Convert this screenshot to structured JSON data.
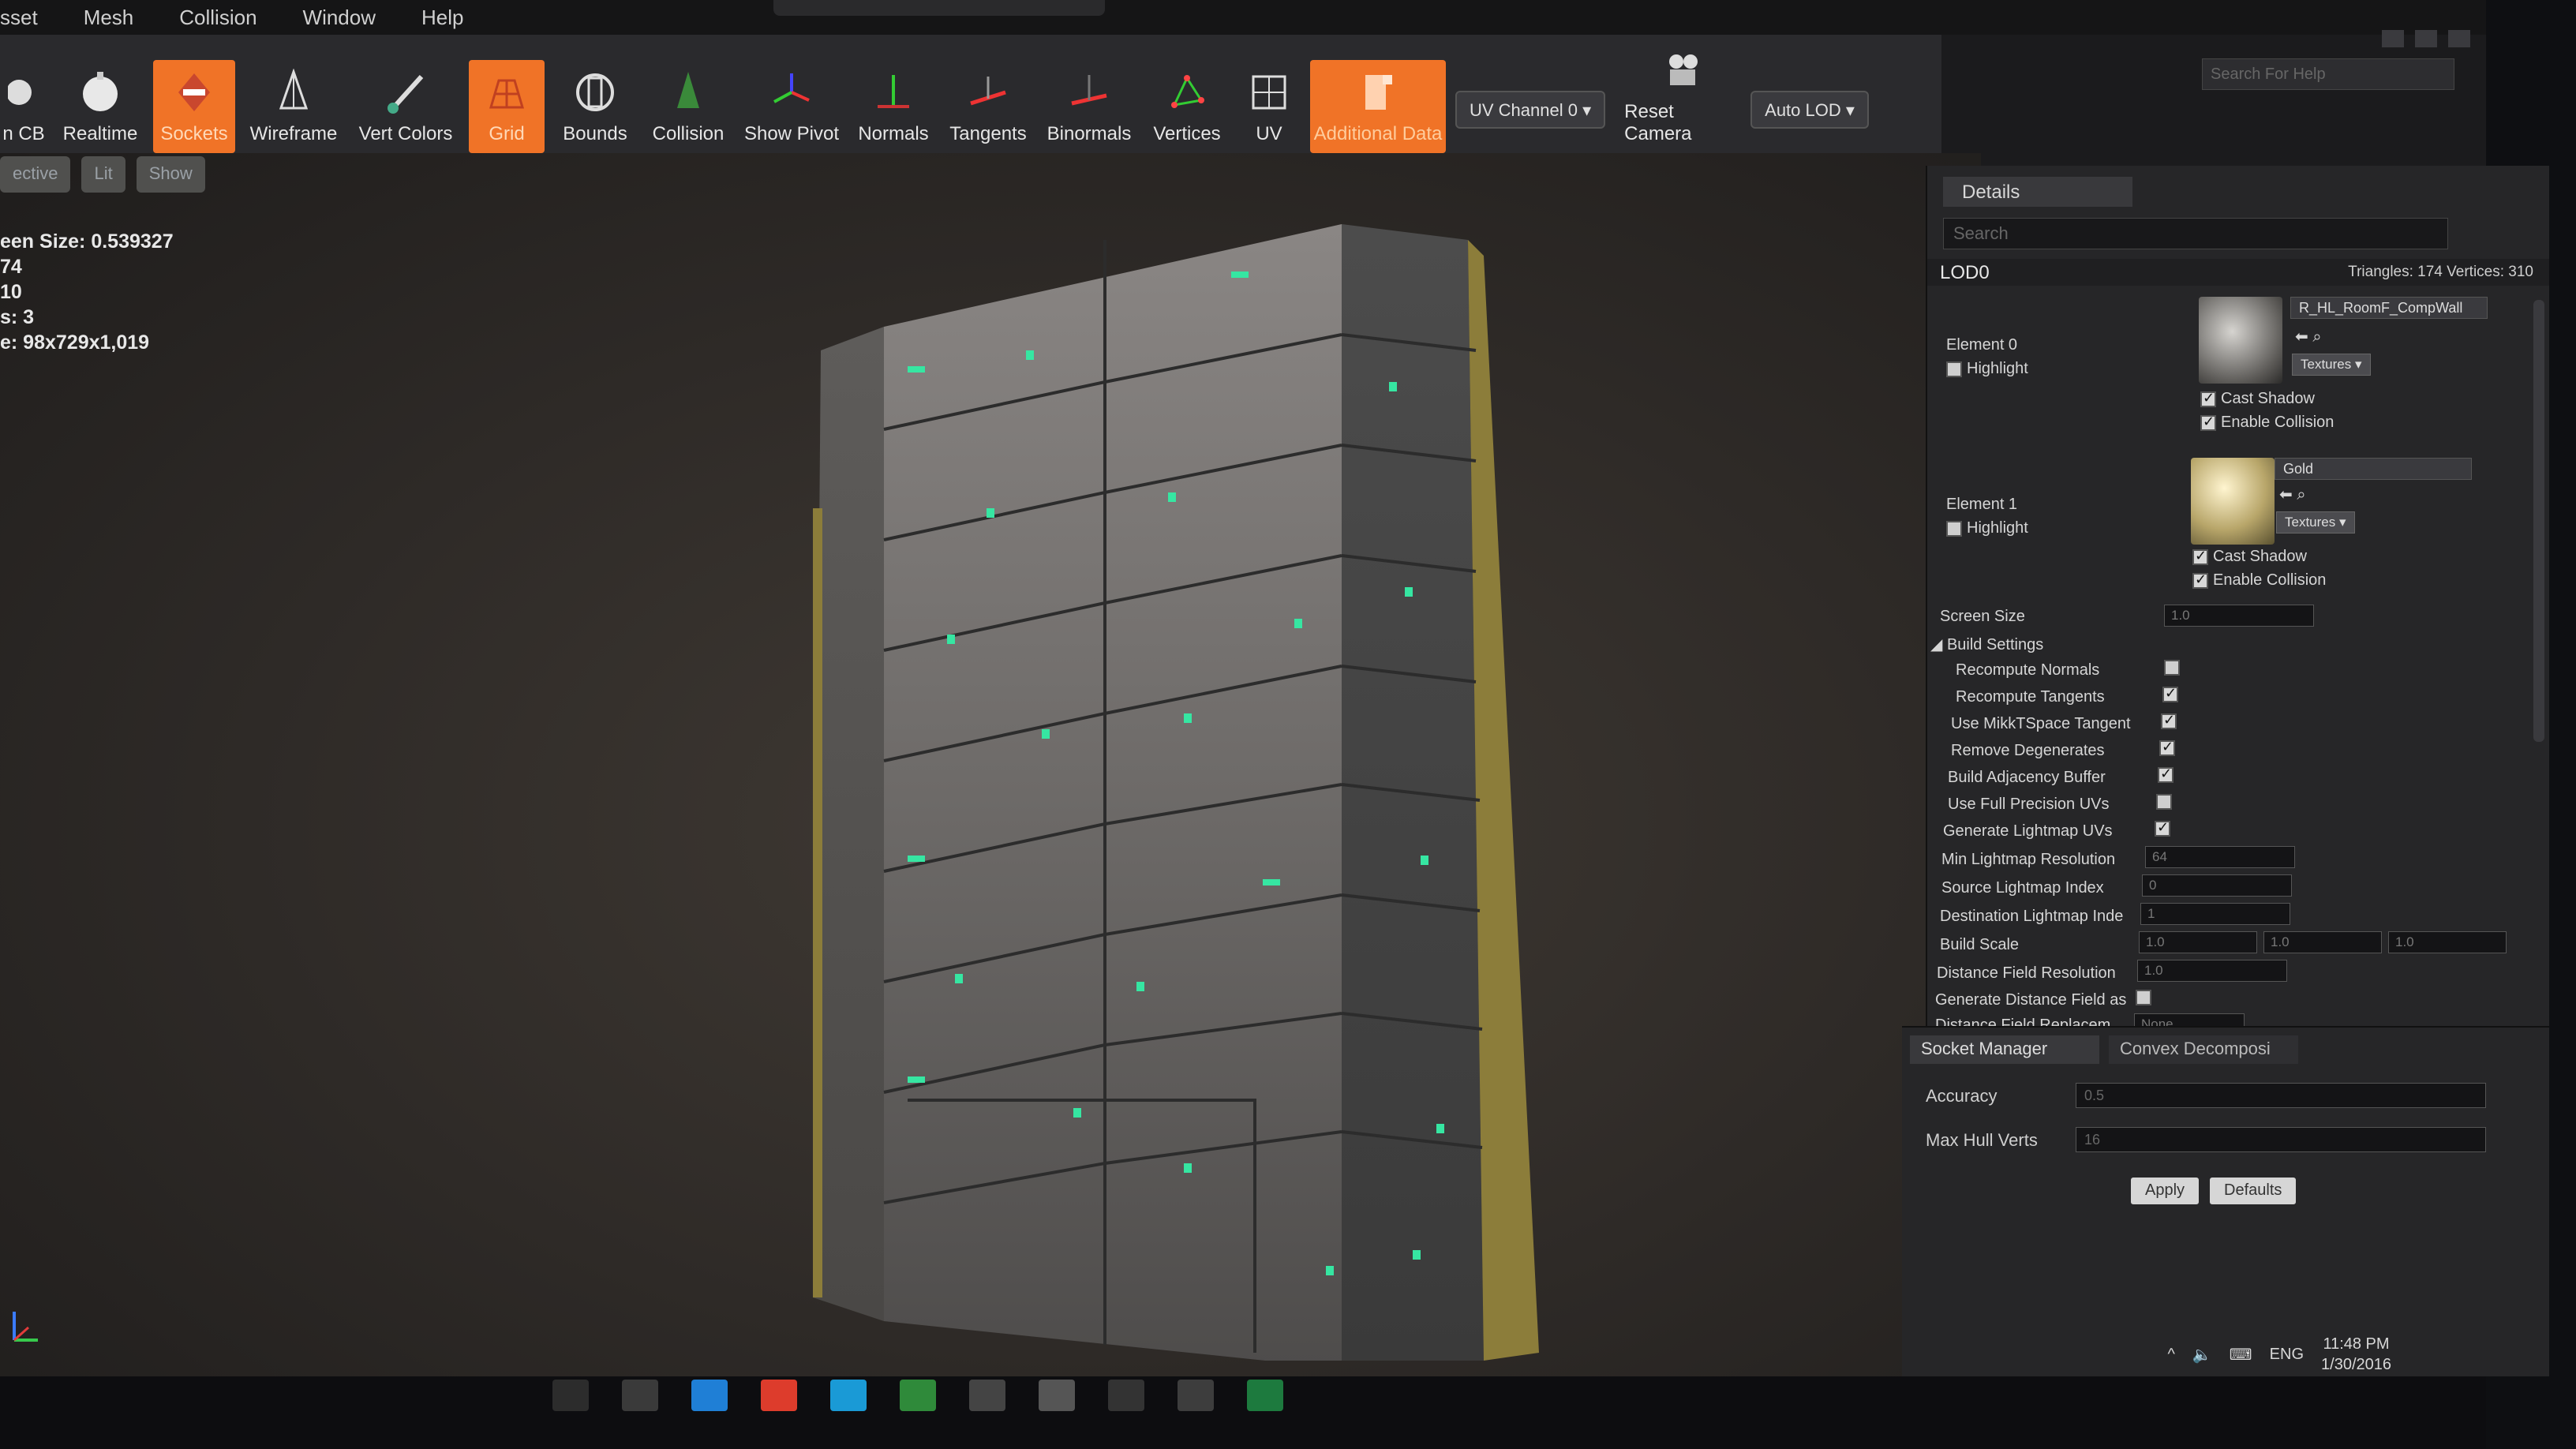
{
  "menu": [
    "sset",
    "Mesh",
    "Collision",
    "Window",
    "Help"
  ],
  "search_help": {
    "placeholder": "Search For Help"
  },
  "toolbar": {
    "items": [
      {
        "label": "n CB",
        "icon": "save-cb-icon",
        "active": false
      },
      {
        "label": "Realtime",
        "icon": "realtime-icon",
        "active": false
      },
      {
        "label": "Sockets",
        "icon": "sockets-icon",
        "active": true
      },
      {
        "label": "Wireframe",
        "icon": "wireframe-icon",
        "active": false
      },
      {
        "label": "Vert Colors",
        "icon": "vert-colors-icon",
        "active": false
      },
      {
        "label": "Grid",
        "icon": "grid-icon",
        "active": true
      },
      {
        "label": "Bounds",
        "icon": "bounds-icon",
        "active": false
      },
      {
        "label": "Collision",
        "icon": "collision-icon",
        "active": false
      },
      {
        "label": "Show Pivot",
        "icon": "pivot-icon",
        "active": false
      },
      {
        "label": "Normals",
        "icon": "normals-icon",
        "active": false
      },
      {
        "label": "Tangents",
        "icon": "tangents-icon",
        "active": false
      },
      {
        "label": "Binormals",
        "icon": "binormals-icon",
        "active": false
      },
      {
        "label": "Vertices",
        "icon": "vertices-icon",
        "active": false
      },
      {
        "label": "UV",
        "icon": "uv-icon",
        "active": false
      },
      {
        "label": "Additional Data",
        "icon": "additional-data-icon",
        "active": true
      }
    ],
    "uv_channel": "UV Channel 0 ▾",
    "reset_camera": "Reset Camera",
    "auto_lod": "Auto LOD ▾"
  },
  "viewport": {
    "buttons": [
      "ective",
      "Lit",
      "Show"
    ],
    "stats": [
      "een Size:  0.539327",
      "74",
      "10",
      "s:  3",
      "e: 98x729x1,019"
    ]
  },
  "details": {
    "tab": "Details",
    "search_placeholder": "Search",
    "lod_title": "LOD0",
    "lod_stats": "Triangles: 174   Vertices: 310",
    "element0": {
      "label": "Element 0",
      "highlight": "Highlight",
      "material": "R_HL_RoomF_CompWall",
      "textures": "Textures ▾",
      "cast_shadow": "Cast Shadow",
      "enable_collision": "Enable Collision"
    },
    "element1": {
      "label": "Element 1",
      "highlight": "Highlight",
      "material": "Gold",
      "textures": "Textures ▾",
      "cast_shadow": "Cast Shadow",
      "enable_collision": "Enable Collision"
    },
    "screen_size": {
      "label": "Screen Size",
      "value": "1.0"
    },
    "build_settings": "Build Settings",
    "settings": [
      {
        "label": "Recompute Normals",
        "checked": false
      },
      {
        "label": "Recompute Tangents",
        "checked": true
      },
      {
        "label": "Use MikkTSpace Tangent",
        "checked": true
      },
      {
        "label": "Remove Degenerates",
        "checked": true
      },
      {
        "label": "Build Adjacency Buffer",
        "checked": true
      },
      {
        "label": "Use Full Precision UVs",
        "checked": false
      },
      {
        "label": "Generate Lightmap UVs",
        "checked": true
      }
    ],
    "min_lightmap": {
      "label": "Min Lightmap Resolution",
      "value": "64"
    },
    "source_lightmap": {
      "label": "Source Lightmap Index",
      "value": "0"
    },
    "dest_lightmap": {
      "label": "Destination Lightmap Inde",
      "value": "1"
    },
    "build_scale": {
      "label": "Build Scale",
      "x": "1.0",
      "y": "1.0",
      "z": "1.0"
    },
    "distance_field": {
      "label": "Distance Field Resolution",
      "value": "1.0"
    },
    "gen_distance_field": "Generate Distance Field as",
    "distance_field_replacement": {
      "label": "Distance Field Replacem",
      "value": "None"
    }
  },
  "bottom": {
    "tab1": "Socket Manager",
    "tab2": "Convex Decomposi",
    "accuracy": {
      "label": "Accuracy",
      "value": "0.5"
    },
    "max_hull": {
      "label": "Max Hull Verts",
      "value": "16"
    },
    "apply": "Apply",
    "defaults": "Defaults"
  },
  "taskbar": {
    "lang": "ENG",
    "time": "11:48 PM",
    "date": "1/30/2016"
  },
  "colors": {
    "accent": "#f07327",
    "panel": "#262628",
    "toolbar": "#2a2a2d"
  }
}
